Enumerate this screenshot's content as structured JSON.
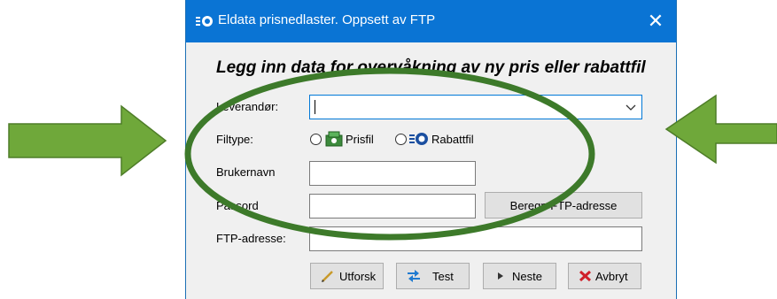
{
  "window": {
    "title": "Eldata prisnedlaster. Oppsett av FTP",
    "close_glyph": "✕",
    "accent_color": "#0a74d4"
  },
  "form": {
    "heading": "Legg inn data for overvåkning av ny pris eller rabattfil",
    "supplier_label": "Leverandør:",
    "supplier_value": "",
    "filetype_label": "Filtype:",
    "filetype_options": [
      {
        "label": "Prisfil",
        "icon": "price-file-icon",
        "selected": false
      },
      {
        "label": "Rabattfil",
        "icon": "discount-file-icon",
        "selected": false
      }
    ],
    "username_label": "Brukernavn",
    "username_value": "",
    "password_label": "Passord",
    "password_value": "",
    "compute_button": "Beregn FTP-adresse",
    "ftp_label": "FTP-adresse:",
    "ftp_value": ""
  },
  "actions": [
    {
      "label": "Utforsk",
      "icon": "pencil-icon"
    },
    {
      "label": "Test",
      "icon": "swap-arrows-icon"
    },
    {
      "label": "Neste",
      "icon": "play-arrow-icon"
    },
    {
      "label": "Avbryt",
      "icon": "red-x-icon"
    }
  ],
  "annotations": {
    "arrow_color": "#6fa83a",
    "ellipse_color": "#3d7a2a"
  }
}
